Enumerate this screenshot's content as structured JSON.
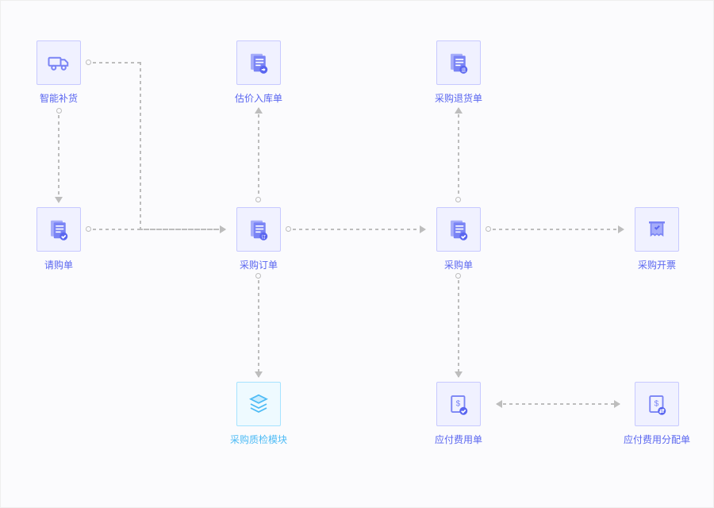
{
  "nodes": {
    "smart_replenish": {
      "label": "智能补货",
      "icon": "truck"
    },
    "purchase_request": {
      "label": "请购单",
      "icon": "doc-check"
    },
    "valuation_inbound": {
      "label": "估价入库单",
      "icon": "doc-arrow"
    },
    "purchase_order": {
      "label": "采购订单",
      "icon": "doc-order"
    },
    "qc_module": {
      "label": "采购质检模块",
      "icon": "layers"
    },
    "purchase_return": {
      "label": "采购退货单",
      "icon": "doc-return"
    },
    "purchase_note": {
      "label": "采购单",
      "icon": "doc-check"
    },
    "payable_expense": {
      "label": "应付费用单",
      "icon": "doc-dollar-check"
    },
    "invoice": {
      "label": "采购开票",
      "icon": "receipt"
    },
    "expense_alloc": {
      "label": "应付费用分配单",
      "icon": "doc-dollar-swap"
    }
  }
}
